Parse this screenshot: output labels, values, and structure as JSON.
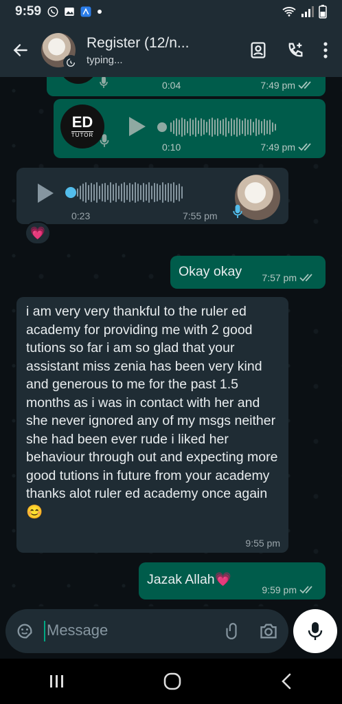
{
  "status_bar": {
    "time": "9:59"
  },
  "header": {
    "title": "Register (12/n...",
    "subtitle": "typing..."
  },
  "messages": {
    "voice1": {
      "duration": "0:04",
      "time": "7:49 pm"
    },
    "voice2": {
      "duration": "0:10",
      "time": "7:49 pm",
      "logo_top": "ED",
      "logo_bottom": "TUTOR"
    },
    "voice3": {
      "duration": "0:23",
      "time": "7:55 pm",
      "reaction": "💗"
    },
    "text1": {
      "text": "Okay okay",
      "time": "7:57 pm"
    },
    "text2": {
      "text": "i am very very thankful to the ruler ed academy for providing me with 2 good tutions so far i am so glad that your assistant miss zenia has been very kind and generous to me for the past 1.5 months as i was in contact with her and she never ignored any of my msgs neither she had been ever rude i liked her behaviour through out and expecting more good tutions in future from your academy thanks alot ruler ed academy once again😊",
      "time": "9:55 pm"
    },
    "text3": {
      "text": "Jazak Allah💗",
      "time": "9:59 pm"
    }
  },
  "composer": {
    "placeholder": "Message"
  },
  "colors": {
    "outgoing": "#005c4b",
    "incoming": "#1f2c34",
    "accent": "#00a884",
    "read_ticks": "#a8c7bf"
  }
}
